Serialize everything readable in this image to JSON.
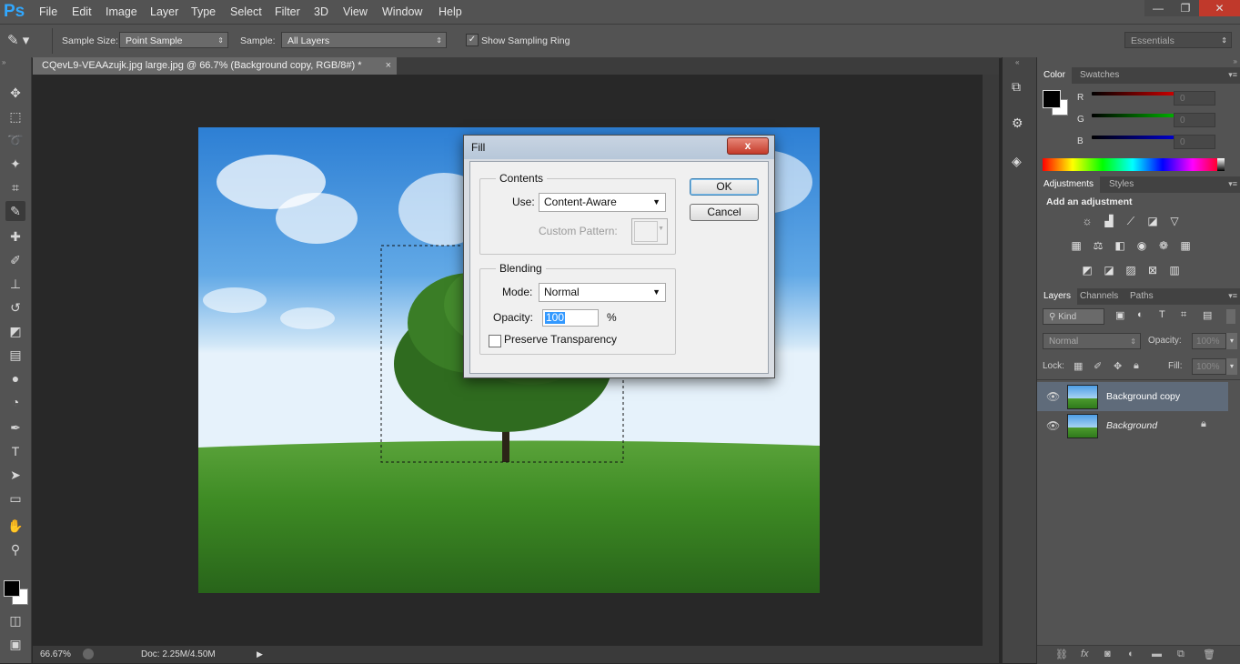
{
  "app": {
    "logo": "Ps"
  },
  "menu": [
    "File",
    "Edit",
    "Image",
    "Layer",
    "Type",
    "Select",
    "Filter",
    "3D",
    "View",
    "Window",
    "Help"
  ],
  "window_controls": {
    "minimize": "—",
    "restore": "❐",
    "close": "✕"
  },
  "options_bar": {
    "sample_size_label": "Sample Size:",
    "sample_size_value": "Point Sample",
    "sample_label": "Sample:",
    "sample_value": "All Layers",
    "show_ring_label": "Show Sampling Ring",
    "show_ring_checked": true,
    "workspace_value": "Essentials"
  },
  "document": {
    "tab_title": "CQevL9-VEAAzujk.jpg large.jpg @ 66.7% (Background copy, RGB/8#) *",
    "tab_close": "×",
    "zoom": "66.67%",
    "doc_info": "Doc: 2.25M/4.50M"
  },
  "panels": {
    "color_tabs": [
      "Color",
      "Swatches"
    ],
    "color_channels": [
      {
        "label": "R",
        "value": "0",
        "color": "#cc0000"
      },
      {
        "label": "G",
        "value": "0",
        "color": "#00aa00"
      },
      {
        "label": "B",
        "value": "0",
        "color": "#0000cc"
      }
    ],
    "adjustments_tabs": [
      "Adjustments",
      "Styles"
    ],
    "add_adjustment": "Add an adjustment",
    "adjust_icons_row1": [
      "brightness-icon",
      "levels-icon",
      "curves-icon",
      "exposure-icon",
      "gradient-map-icon"
    ],
    "adjust_icons_row2": [
      "vibrance-icon",
      "balance-icon",
      "black-white-icon",
      "photo-filter-icon",
      "channel-mixer-icon",
      "color-lookup-icon"
    ],
    "adjust_icons_row3": [
      "invert-icon",
      "posterize-icon",
      "threshold-icon",
      "selective-color-icon",
      "gradient-icon"
    ],
    "layers_tabs": [
      "Layers",
      "Channels",
      "Paths"
    ],
    "layers_kind": "Kind",
    "blend_mode": "Normal",
    "opacity_label": "Opacity:",
    "opacity_value": "100%",
    "lock_label": "Lock:",
    "fill_label": "Fill:",
    "fill_value": "100%",
    "layers": [
      {
        "name": "Background copy",
        "selected": true,
        "italic": false,
        "locked": false
      },
      {
        "name": "Background",
        "selected": false,
        "italic": true,
        "locked": true
      }
    ]
  },
  "dialog": {
    "title": "Fill",
    "close": "x",
    "contents_legend": "Contents",
    "use_label": "Use:",
    "use_value": "Content-Aware",
    "custom_pattern_label": "Custom Pattern:",
    "blending_legend": "Blending",
    "mode_label": "Mode:",
    "mode_value": "Normal",
    "opacity_label": "Opacity:",
    "opacity_value": "100",
    "opacity_unit": "%",
    "preserve_label": "Preserve Transparency",
    "preserve_checked": false,
    "ok_label": "OK",
    "cancel_label": "Cancel"
  }
}
